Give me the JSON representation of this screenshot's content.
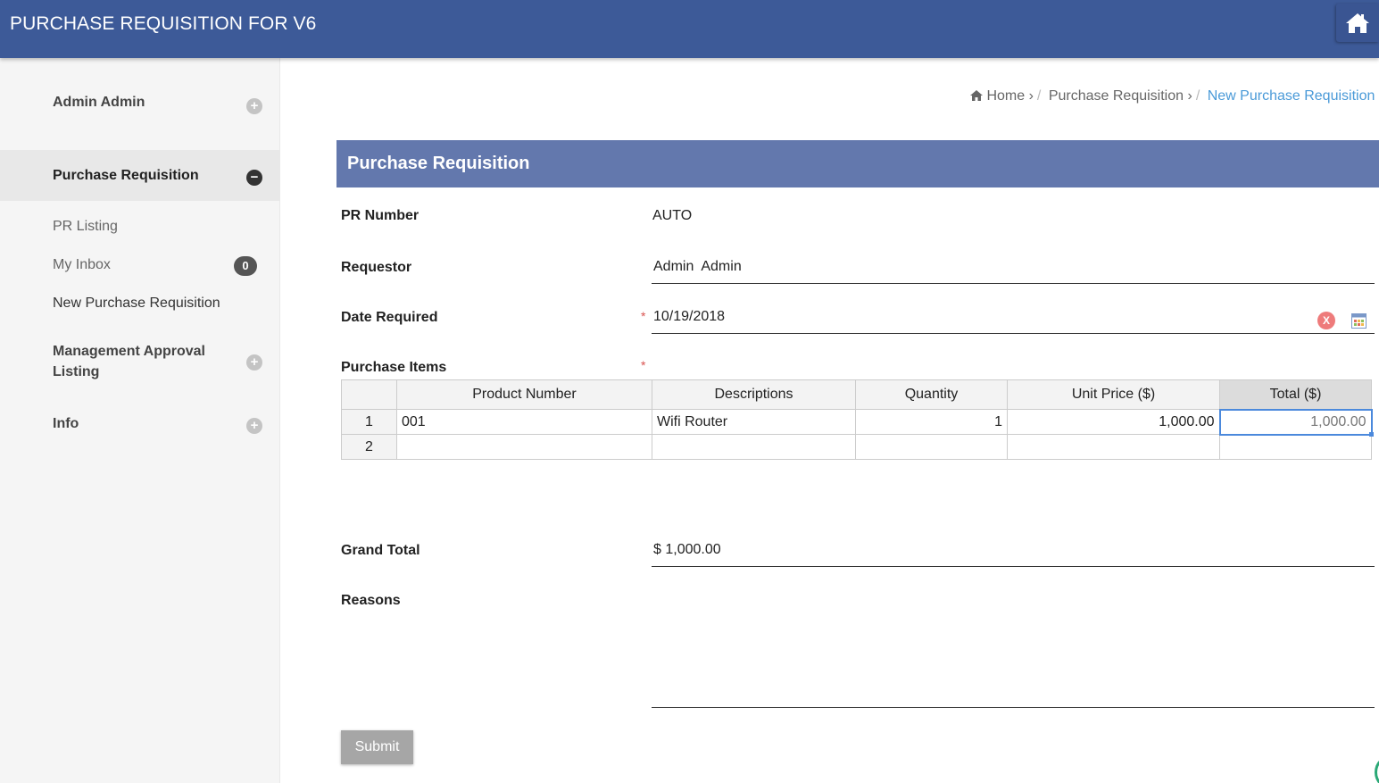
{
  "header": {
    "title": "PURCHASE REQUISITION FOR V6",
    "home_icon": "home-icon"
  },
  "sidebar": {
    "user": "Admin Admin",
    "section_pr": "Purchase Requisition",
    "sub_items": [
      {
        "label": "PR Listing"
      },
      {
        "label": "My Inbox",
        "badge": "0"
      },
      {
        "label": "New Purchase Requisition"
      }
    ],
    "section_mgmt": "Management Approval Listing",
    "section_info": "Info",
    "expand_symbol": "+",
    "collapse_symbol": "−"
  },
  "breadcrumb": {
    "home": "Home",
    "chev": "›",
    "slash": "/",
    "level1": "Purchase Requisition",
    "current": "New Purchase Requisition"
  },
  "panel": {
    "title": "Purchase Requisition"
  },
  "form": {
    "pr_number_label": "PR Number",
    "pr_number_value": "AUTO",
    "requestor_label": "Requestor",
    "requestor_value": "Admin  Admin",
    "date_label": "Date Required",
    "date_value": "10/19/2018",
    "clear_symbol": "X",
    "items_label": "Purchase Items",
    "required_mark": "*",
    "grand_total_label": "Grand Total",
    "grand_total_value": "$ 1,000.00",
    "reasons_label": "Reasons",
    "reasons_value": "",
    "submit_label": "Submit"
  },
  "grid": {
    "headers": [
      "Product Number",
      "Descriptions",
      "Quantity",
      "Unit Price ($)",
      "Total ($)"
    ],
    "rows": [
      {
        "num": "1",
        "product": "001",
        "desc": "Wifi Router",
        "qty": "1",
        "unit": "1,000.00",
        "total": "1,000.00"
      },
      {
        "num": "2",
        "product": "",
        "desc": "",
        "qty": "",
        "unit": "",
        "total": ""
      }
    ]
  },
  "colors": {
    "header_bg": "#3d5a98",
    "panel_bg": "#6378ad",
    "link": "#4a9ad8",
    "required": "#d9534f"
  }
}
